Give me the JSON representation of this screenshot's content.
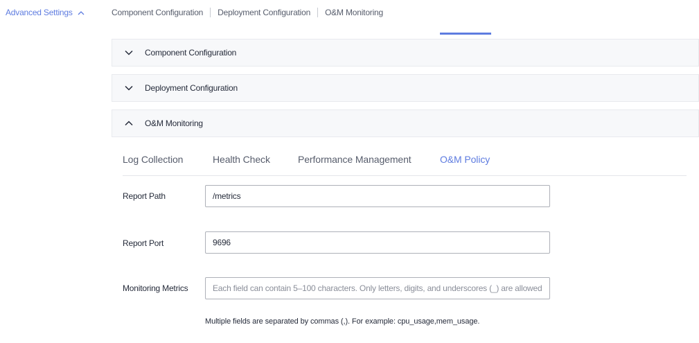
{
  "advanced": {
    "label": "Advanced Settings"
  },
  "anchors": [
    "Component Configuration",
    "Deployment Configuration",
    "O&M Monitoring"
  ],
  "panels": [
    {
      "title": "Component Configuration",
      "expanded": false
    },
    {
      "title": "Deployment Configuration",
      "expanded": false
    },
    {
      "title": "O&M Monitoring",
      "expanded": true
    }
  ],
  "tabs": [
    "Log Collection",
    "Health Check",
    "Performance Management",
    "O&M Policy"
  ],
  "active_tab": "O&M Policy",
  "form": {
    "report_path": {
      "label": "Report Path",
      "value": "/metrics"
    },
    "report_port": {
      "label": "Report Port",
      "value": "9696"
    },
    "metrics": {
      "label": "Monitoring Metrics",
      "value": "",
      "placeholder": "Each field can contain 5–100 characters. Only letters, digits, and underscores (_) are allowed.",
      "hint": "Multiple fields are separated by commas (,). For example: cpu_usage,mem_usage."
    }
  },
  "colors": {
    "accent": "#5e7ce0",
    "header_bg": "#f7f8fa",
    "border": "#adb0b8"
  }
}
